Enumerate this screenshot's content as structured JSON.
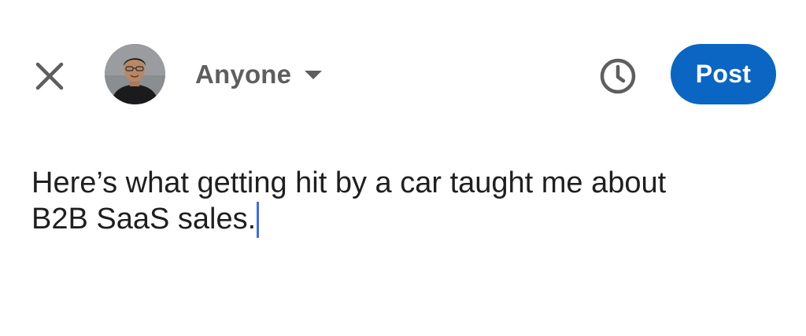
{
  "header": {
    "close_icon": "close-icon",
    "avatar_icon": "profile-photo",
    "visibility": {
      "label": "Anyone",
      "icon": "caret-down-icon"
    },
    "schedule_icon": "clock-icon",
    "post_label": "Post"
  },
  "editor": {
    "line1": "Here’s what getting hit by a car taught me about",
    "line2": "B2B SaaS sales."
  },
  "colors": {
    "primary": "#0a66c2",
    "icon": "#5e5e5e",
    "text": "#1f1f1f",
    "cursor": "#3a6fe0"
  }
}
